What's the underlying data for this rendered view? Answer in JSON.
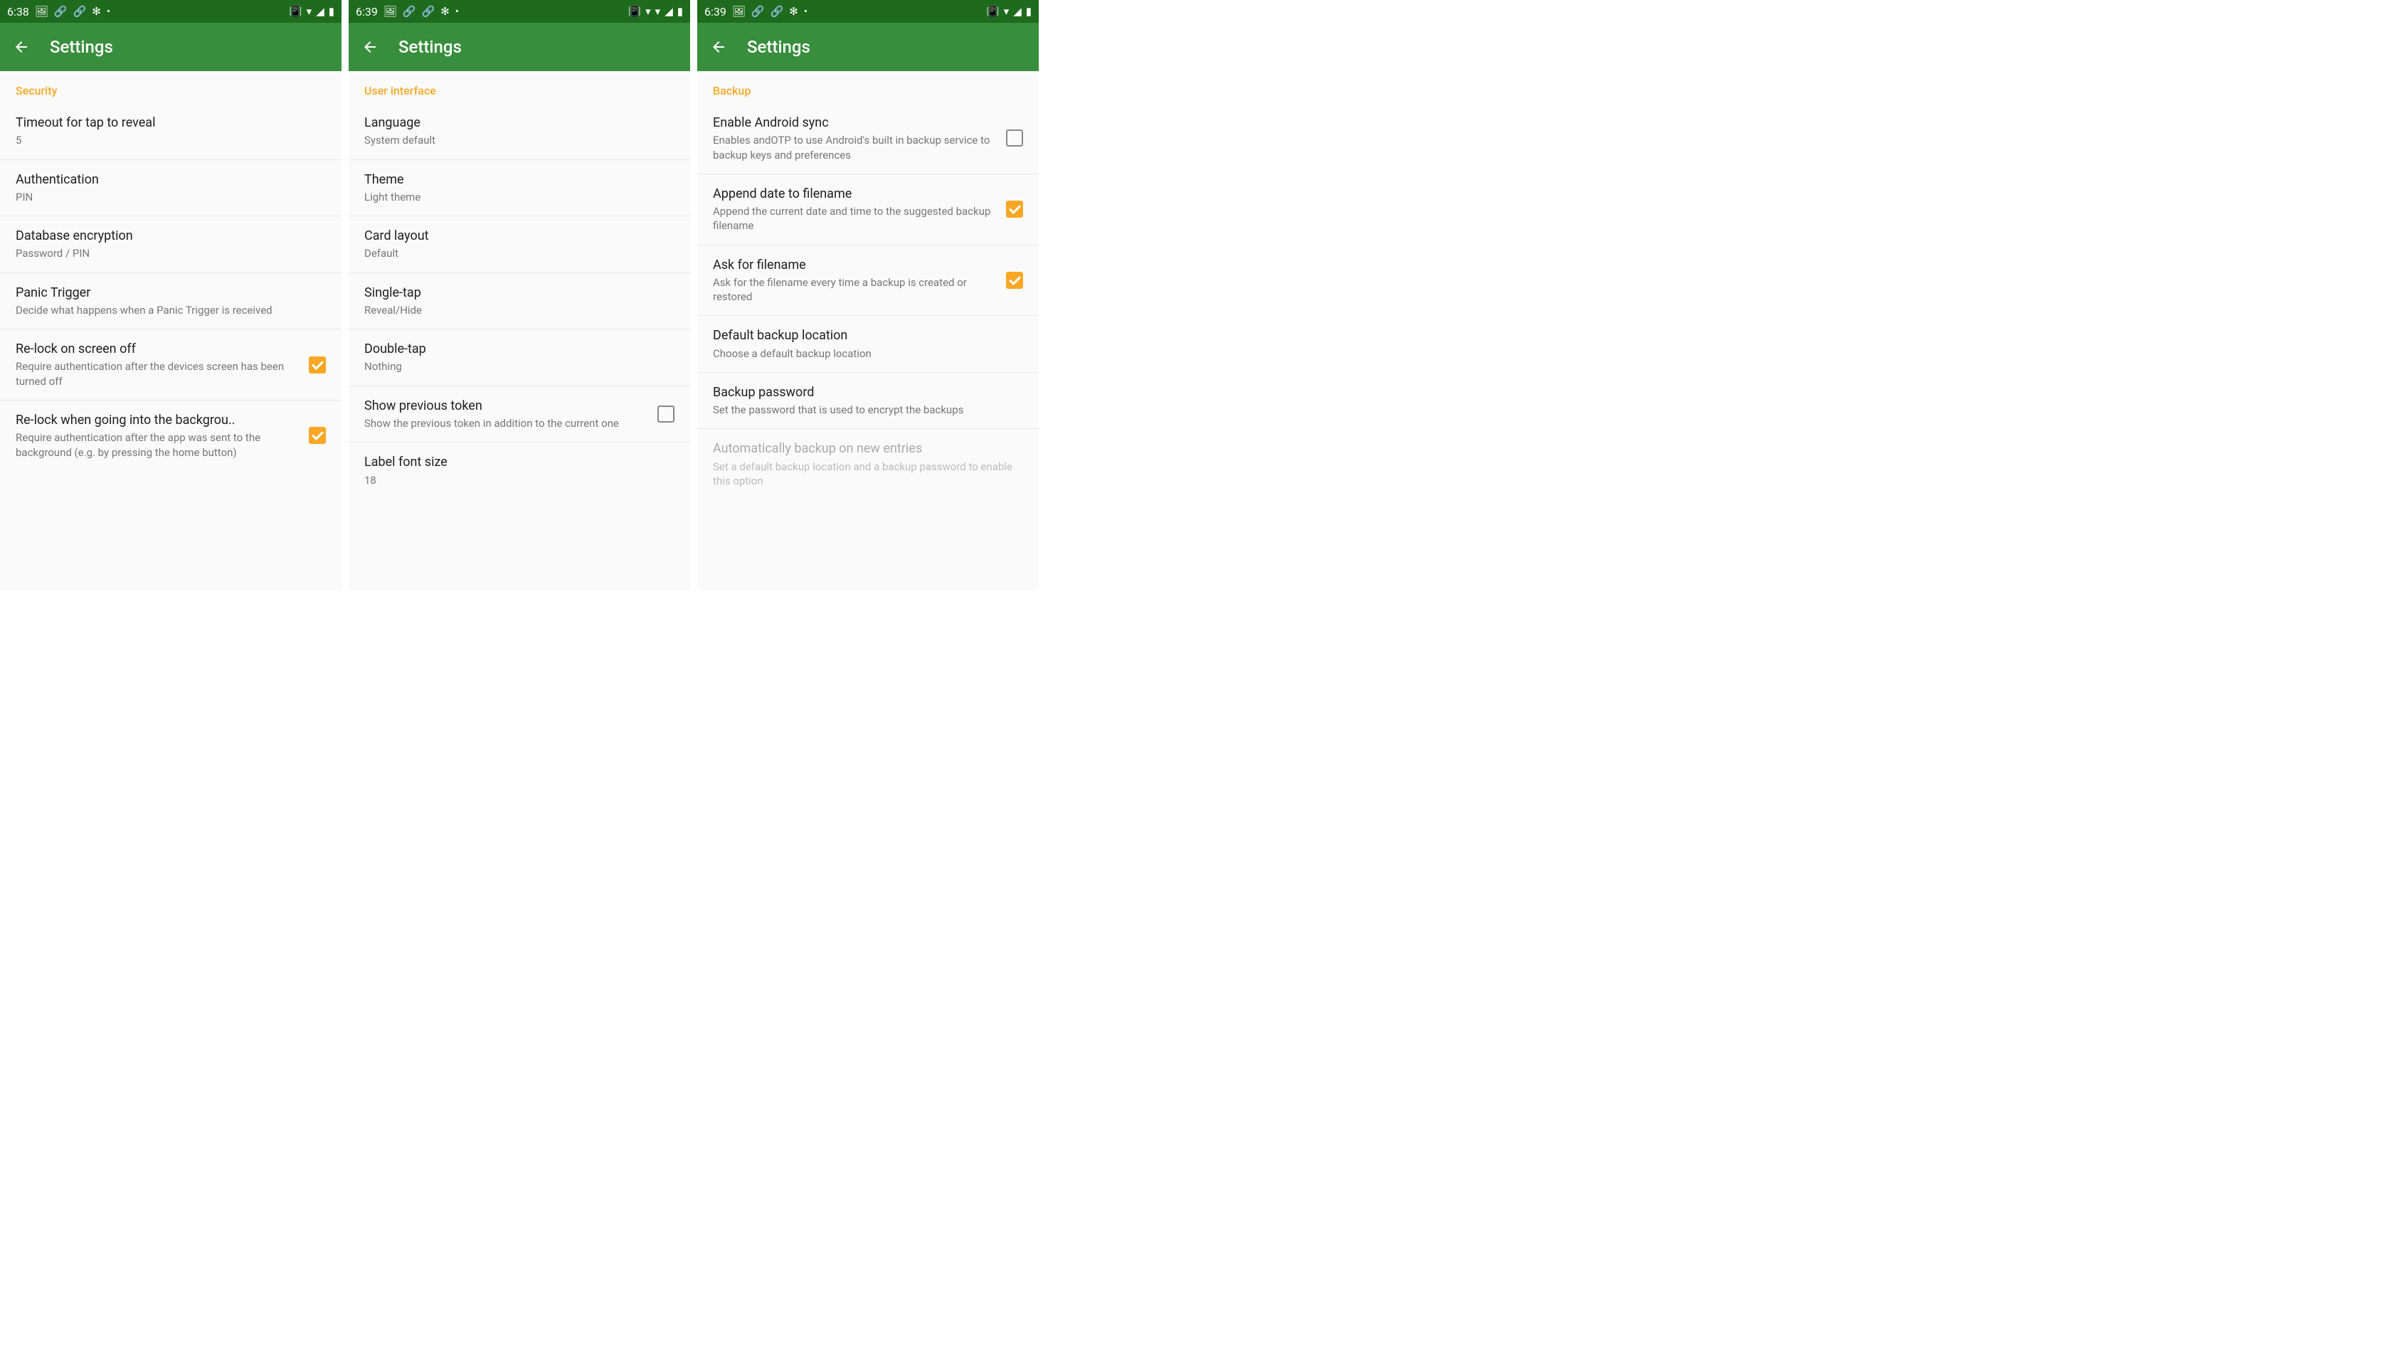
{
  "screens": [
    {
      "time": "6:38",
      "title": "Settings",
      "section": "Security",
      "status_icons_left": [
        "🖼",
        "🔄",
        "🔄",
        "✻",
        "•"
      ],
      "status_icons_right": [
        "📳",
        "▼",
        "◢",
        "🔋"
      ],
      "rows": [
        {
          "title": "Timeout for tap to reveal",
          "sub": "5"
        },
        {
          "title": "Authentication",
          "sub": "PIN"
        },
        {
          "title": "Database encryption",
          "sub": "Password / PIN"
        },
        {
          "title": "Panic Trigger",
          "sub": "Decide what happens when a Panic Trigger is received"
        },
        {
          "title": "Re-lock on screen off",
          "sub": "Require authentication after the devices screen has been turned off",
          "checked": true
        },
        {
          "title": "Re-lock when going into the backgrou..",
          "sub": "Require authentication after the app was sent to the background (e.g. by pressing the home button)",
          "checked": true,
          "ellipsis": true
        }
      ]
    },
    {
      "time": "6:39",
      "title": "Settings",
      "section": "User interface",
      "status_icons_left": [
        "🖼",
        "🔄",
        "🔄",
        "✻",
        "•"
      ],
      "status_icons_right": [
        "📳",
        "▾",
        "▼",
        "◢",
        "🔋"
      ],
      "rows": [
        {
          "title": "Language",
          "sub": "System default"
        },
        {
          "title": "Theme",
          "sub": "Light theme"
        },
        {
          "title": "Card layout",
          "sub": "Default"
        },
        {
          "title": "Single-tap",
          "sub": "Reveal/Hide"
        },
        {
          "title": "Double-tap",
          "sub": "Nothing"
        },
        {
          "title": "Show previous token",
          "sub": "Show the previous token in addition to the current one",
          "checked": false
        },
        {
          "title": "Label font size",
          "sub": "18"
        }
      ]
    },
    {
      "time": "6:39",
      "title": "Settings",
      "section": "Backup",
      "status_icons_left": [
        "🖼",
        "🔄",
        "🔄",
        "✻",
        "•"
      ],
      "status_icons_right": [
        "📳",
        "▼",
        "◢",
        "🔋"
      ],
      "rows": [
        {
          "title": "Enable Android sync",
          "sub": "Enables andOTP to use Android's built in backup service to backup keys and preferences",
          "checked": false
        },
        {
          "title": "Append date to filename",
          "sub": "Append the current date and time to the suggested backup filename",
          "checked": true
        },
        {
          "title": "Ask for filename",
          "sub": "Ask for the filename every time a backup is created or restored",
          "checked": true
        },
        {
          "title": "Default backup location",
          "sub": "Choose a default backup location"
        },
        {
          "title": "Backup password",
          "sub": "Set the password that is used to encrypt the backups"
        },
        {
          "title": "Automatically backup on new entries",
          "sub": "Set a default backup location and a backup password to enable this option",
          "disabled": true
        }
      ]
    }
  ]
}
